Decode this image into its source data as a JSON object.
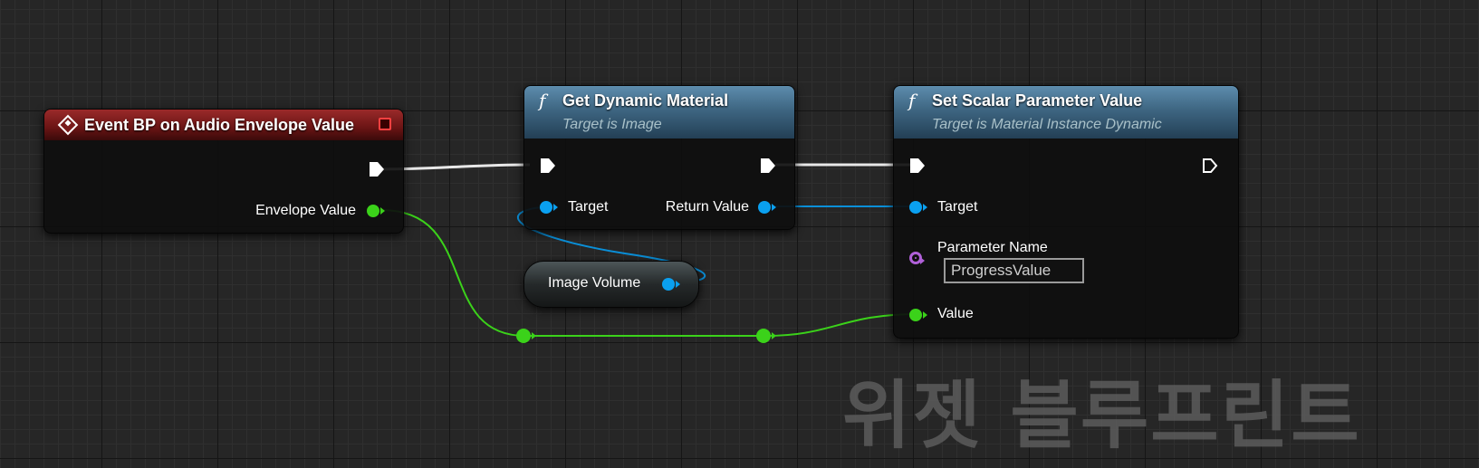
{
  "event_node": {
    "title": "Event BP on Audio Envelope Value",
    "output_label": "Envelope Value"
  },
  "get_node": {
    "title": "Get Dynamic Material",
    "subtitle": "Target is Image",
    "input_label": "Target",
    "output_label": "Return Value"
  },
  "variable_node": {
    "label": "Image Volume"
  },
  "set_node": {
    "title": "Set Scalar Parameter Value",
    "subtitle": "Target is Material Instance Dynamic",
    "target_label": "Target",
    "param_label": "Parameter Name",
    "param_value": "ProgressValue",
    "value_label": "Value"
  },
  "watermark": "위젯 블루프린트",
  "colors": {
    "object_pin": "#0aa0f0",
    "float_pin": "#3bd21a",
    "name_pin": "#b060d8",
    "event_header": "#9a2a2a",
    "function_header": "#3e6682"
  },
  "icons": {
    "event": "event-diamond-icon",
    "function": "function-f-icon",
    "stop": "stop-square-icon"
  }
}
